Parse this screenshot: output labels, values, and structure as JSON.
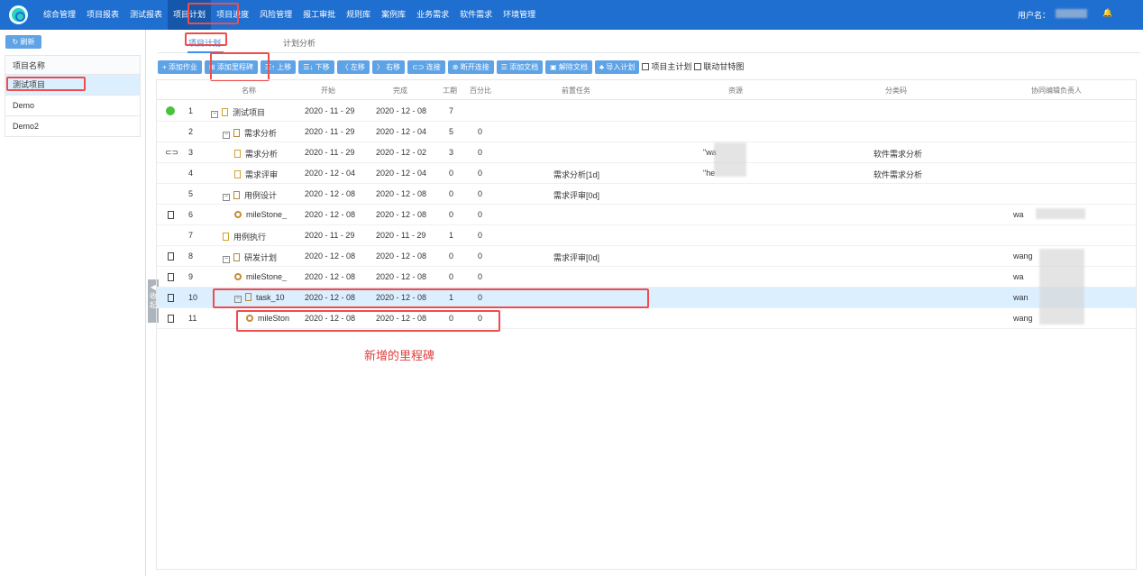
{
  "topbar": {
    "nav": [
      "综合管理",
      "项目报表",
      "测试报表",
      "项目计划",
      "项目进度",
      "风险管理",
      "报工审批",
      "规则库",
      "案例库",
      "业务需求",
      "软件需求",
      "环境管理"
    ],
    "active_nav": "项目计划",
    "user_label": "用户名："
  },
  "sidebar": {
    "refresh": "刷新",
    "header": "项目名称",
    "projects": [
      "测试项目",
      "Demo",
      "Demo2"
    ],
    "collapse": "收起"
  },
  "tabs": [
    "项目计划",
    "计划分析"
  ],
  "toolbar": {
    "buttons": [
      "+ 添加作业",
      "⊞ 添加里程碑",
      "☰↑ 上移",
      "☰↓ 下移",
      "〈 左移",
      "〉 右移",
      "⊂⊃ 连接",
      "⊗ 断开连接",
      "☰ 添加文档",
      "▣ 解除文档",
      "♣ 导入计划"
    ],
    "checks": [
      "项目主计划",
      "联动甘特图"
    ]
  },
  "grid": {
    "headers": [
      "名称",
      "开始",
      "完成",
      "工期",
      "百分比",
      "前置任务",
      "资源",
      "分类码",
      "协同编辑负责人"
    ],
    "rows": [
      {
        "id": "1",
        "name": "测试项目",
        "start": "2020 - 11 - 29",
        "finish": "2020 - 12 - 08",
        "duration": "7",
        "percent": "",
        "pred": "",
        "resource": "",
        "category": "",
        "owner": "",
        "mark": "dot",
        "level": 0,
        "toggle": "−",
        "icon": "doc"
      },
      {
        "id": "2",
        "name": "需求分析",
        "start": "2020 - 11 - 29",
        "finish": "2020 - 12 - 04",
        "duration": "5",
        "percent": "0",
        "pred": "",
        "resource": "",
        "category": "",
        "owner": "",
        "mark": "",
        "level": 1,
        "toggle": "−",
        "icon": "folder"
      },
      {
        "id": "3",
        "name": "需求分析",
        "start": "2020 - 11 - 29",
        "finish": "2020 - 12 - 02",
        "duration": "3",
        "percent": "0",
        "pred": "",
        "resource": "\"wa",
        "category": "软件需求分析",
        "owner": "",
        "mark": "link",
        "level": 2,
        "toggle": "",
        "icon": "file"
      },
      {
        "id": "4",
        "name": "需求评审",
        "start": "2020 - 12 - 04",
        "finish": "2020 - 12 - 04",
        "duration": "0",
        "percent": "0",
        "pred": "需求分析[1d]",
        "resource": "\"he",
        "category": "软件需求分析",
        "owner": "",
        "mark": "",
        "level": 2,
        "toggle": "",
        "icon": "file"
      },
      {
        "id": "5",
        "name": "用例设计",
        "start": "2020 - 12 - 08",
        "finish": "2020 - 12 - 08",
        "duration": "0",
        "percent": "0",
        "pred": "需求评审[0d]",
        "resource": "",
        "category": "",
        "owner": "",
        "mark": "",
        "level": 1,
        "toggle": "−",
        "icon": "folder"
      },
      {
        "id": "6",
        "name": "mileStone_",
        "start": "2020 - 12 - 08",
        "finish": "2020 - 12 - 08",
        "duration": "0",
        "percent": "0",
        "pred": "",
        "resource": "",
        "category": "",
        "owner": "wa",
        "mark": "doc",
        "level": 2,
        "toggle": "",
        "icon": "milestone"
      },
      {
        "id": "7",
        "name": "用例执行",
        "start": "2020 - 11 - 29",
        "finish": "2020 - 11 - 29",
        "duration": "1",
        "percent": "0",
        "pred": "",
        "resource": "",
        "category": "",
        "owner": "",
        "mark": "",
        "level": 1,
        "toggle": "",
        "icon": "file"
      },
      {
        "id": "8",
        "name": "研发计划",
        "start": "2020 - 12 - 08",
        "finish": "2020 - 12 - 08",
        "duration": "0",
        "percent": "0",
        "pred": "需求评审[0d]",
        "resource": "",
        "category": "",
        "owner": "wang",
        "mark": "doc",
        "level": 1,
        "toggle": "−",
        "icon": "folder"
      },
      {
        "id": "9",
        "name": "mileStone_",
        "start": "2020 - 12 - 08",
        "finish": "2020 - 12 - 08",
        "duration": "0",
        "percent": "0",
        "pred": "",
        "resource": "",
        "category": "",
        "owner": "wa",
        "mark": "doc",
        "level": 2,
        "toggle": "",
        "icon": "milestone"
      },
      {
        "id": "10",
        "name": "task_10",
        "start": "2020 - 12 - 08",
        "finish": "2020 - 12 - 08",
        "duration": "1",
        "percent": "0",
        "pred": "",
        "resource": "",
        "category": "",
        "owner": "wan",
        "mark": "doc",
        "level": 2,
        "toggle": "−",
        "icon": "folder"
      },
      {
        "id": "11",
        "name": "mileSton",
        "start": "2020 - 12 - 08",
        "finish": "2020 - 12 - 08",
        "duration": "0",
        "percent": "0",
        "pred": "",
        "resource": "",
        "category": "",
        "owner": "wang",
        "mark": "doc",
        "level": 3,
        "toggle": "",
        "icon": "milestone"
      }
    ]
  },
  "annotation": "新增的里程碑"
}
